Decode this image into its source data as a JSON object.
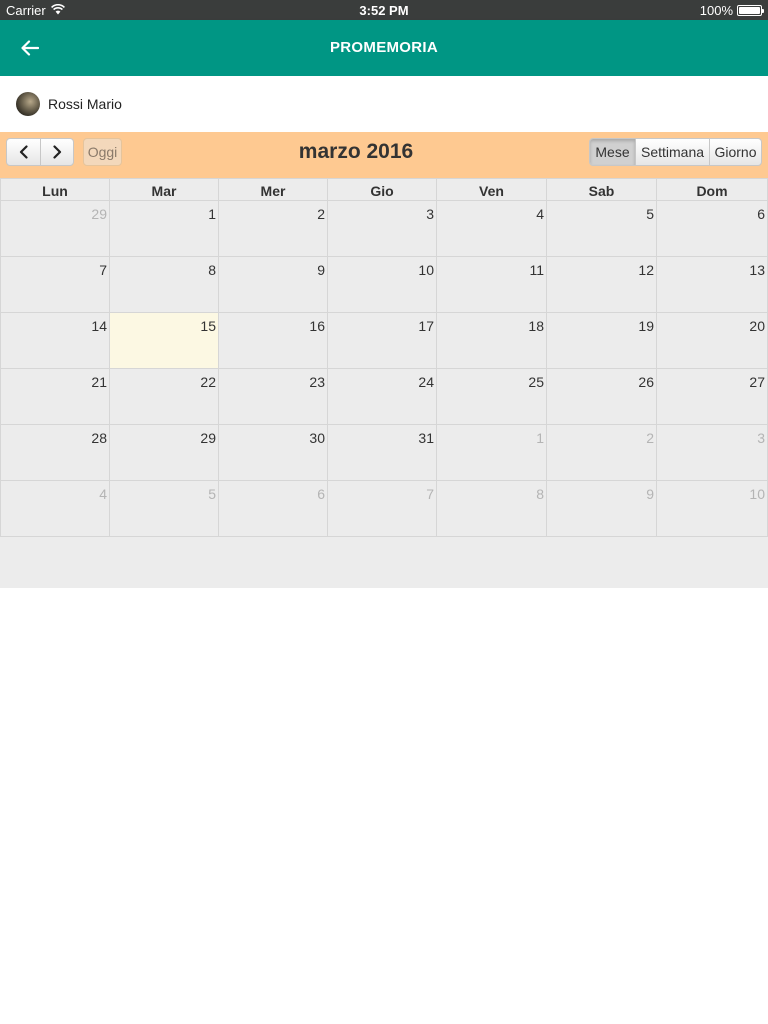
{
  "status_bar": {
    "carrier": "Carrier",
    "time": "3:52 PM",
    "battery": "100%"
  },
  "app_bar": {
    "title": "PROMEMORIA"
  },
  "user": {
    "name": "Rossi Mario"
  },
  "calendar": {
    "title": "marzo 2016",
    "today_label": "Oggi",
    "views": [
      "Mese",
      "Settimana",
      "Giorno"
    ],
    "active_view": "Mese",
    "weekdays": [
      "Lun",
      "Mar",
      "Mer",
      "Gio",
      "Ven",
      "Sab",
      "Dom"
    ],
    "weeks": [
      [
        {
          "d": "29",
          "o": true
        },
        {
          "d": "1"
        },
        {
          "d": "2"
        },
        {
          "d": "3"
        },
        {
          "d": "4"
        },
        {
          "d": "5"
        },
        {
          "d": "6"
        }
      ],
      [
        {
          "d": "7"
        },
        {
          "d": "8"
        },
        {
          "d": "9"
        },
        {
          "d": "10"
        },
        {
          "d": "11"
        },
        {
          "d": "12"
        },
        {
          "d": "13"
        }
      ],
      [
        {
          "d": "14"
        },
        {
          "d": "15",
          "t": true
        },
        {
          "d": "16"
        },
        {
          "d": "17"
        },
        {
          "d": "18"
        },
        {
          "d": "19"
        },
        {
          "d": "20"
        }
      ],
      [
        {
          "d": "21"
        },
        {
          "d": "22"
        },
        {
          "d": "23"
        },
        {
          "d": "24"
        },
        {
          "d": "25"
        },
        {
          "d": "26"
        },
        {
          "d": "27"
        }
      ],
      [
        {
          "d": "28"
        },
        {
          "d": "29"
        },
        {
          "d": "30"
        },
        {
          "d": "31"
        },
        {
          "d": "1",
          "o": true
        },
        {
          "d": "2",
          "o": true
        },
        {
          "d": "3",
          "o": true
        }
      ],
      [
        {
          "d": "4",
          "o": true
        },
        {
          "d": "5",
          "o": true
        },
        {
          "d": "6",
          "o": true
        },
        {
          "d": "7",
          "o": true
        },
        {
          "d": "8",
          "o": true
        },
        {
          "d": "9",
          "o": true
        },
        {
          "d": "10",
          "o": true
        }
      ]
    ]
  },
  "colors": {
    "app_bar": "#009684",
    "toolbar": "#fec991",
    "today_cell": "#fcf8e3",
    "grid_bg": "#ececec"
  }
}
